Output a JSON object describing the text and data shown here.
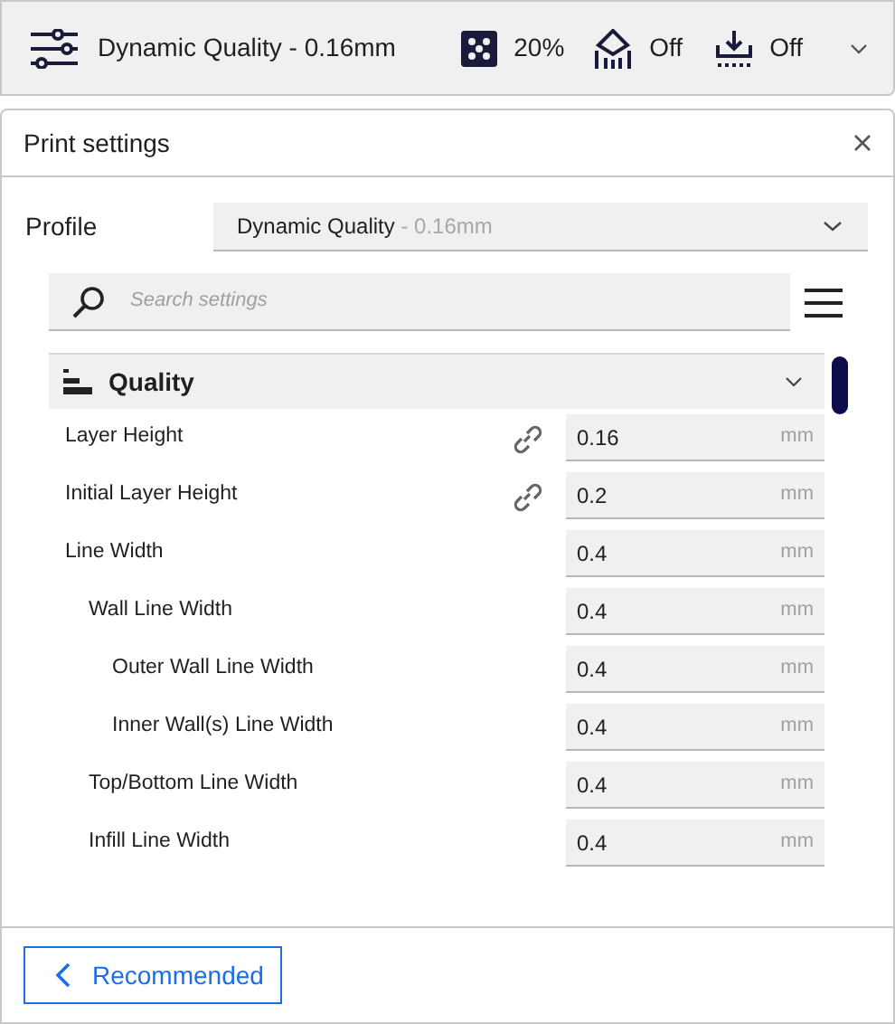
{
  "top_bar": {
    "profile": "Dynamic Quality - 0.16mm",
    "infill": "20%",
    "support": "Off",
    "adhesion": "Off"
  },
  "panel": {
    "title": "Print settings",
    "profile_label": "Profile",
    "profile_name": "Dynamic Quality",
    "profile_detail": " - 0.16mm",
    "search": {
      "placeholder": "Search settings"
    }
  },
  "category": {
    "label": "Quality",
    "expanded": true
  },
  "settings": [
    {
      "label": "Layer Height",
      "value": "0.16",
      "unit": "mm",
      "linked": true
    },
    {
      "label": "Initial Layer Height",
      "value": "0.2",
      "unit": "mm",
      "linked": true
    },
    {
      "label": "Line Width",
      "value": "0.4",
      "unit": "mm",
      "children": [
        {
          "label": "Wall Line Width",
          "value": "0.4",
          "unit": "mm",
          "children": [
            {
              "label": "Outer Wall Line Width",
              "value": "0.4",
              "unit": "mm"
            },
            {
              "label": "Inner Wall(s) Line Width",
              "value": "0.4",
              "unit": "mm"
            }
          ]
        },
        {
          "label": "Top/Bottom Line Width",
          "value": "0.4",
          "unit": "mm"
        },
        {
          "label": "Infill Line Width",
          "value": "0.4",
          "unit": "mm"
        }
      ]
    }
  ],
  "footer": {
    "button": "Recommended"
  }
}
